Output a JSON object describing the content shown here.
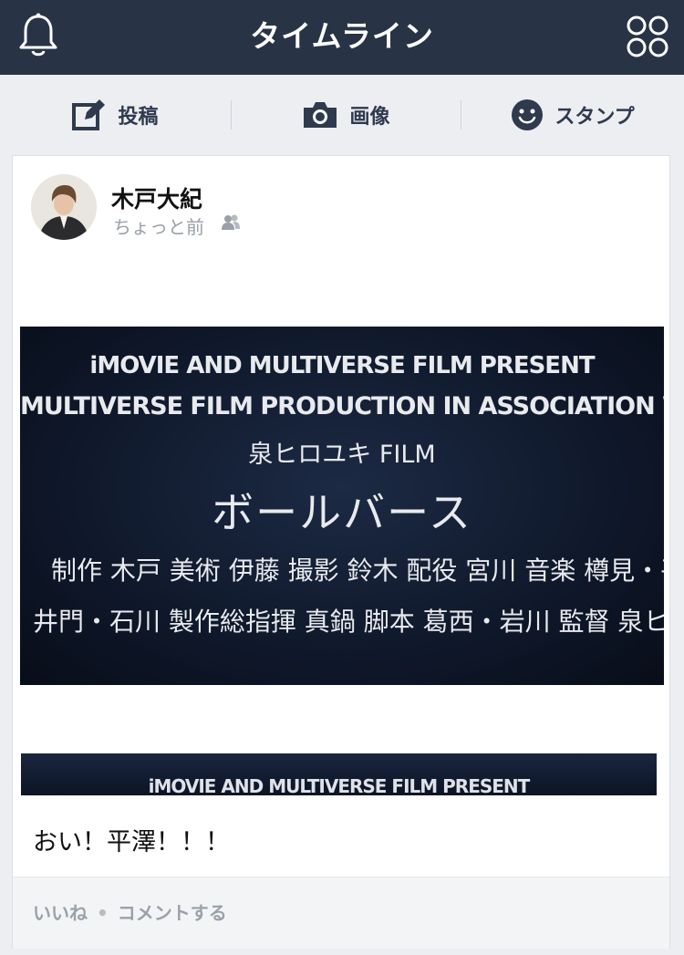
{
  "header": {
    "title": "タイムライン"
  },
  "actions": [
    {
      "label": "投稿",
      "icon": "compose-icon"
    },
    {
      "label": "画像",
      "icon": "camera-icon"
    },
    {
      "label": "スタンプ",
      "icon": "smiley-icon"
    }
  ],
  "post": {
    "author": "木戸大紀",
    "time": "ちょっと前",
    "credits": {
      "line1": "iMOVIE AND MULTIVERSE FILM PRESENT",
      "line2": "MULTIVERSE FILM PRODUCTION IN ASSOCIATION WITH iMOVIE",
      "line3": "泉ヒロユキ FILM",
      "title": "ボールバース",
      "line5": "制作 木戸 美術 伊藤 撮影 鈴木 配役 宮川 音楽 樽見・平澤",
      "line6": "井門・石川 製作総指揮 真鍋 脚本 葛西・岩川 監督 泉ヒロユキ"
    },
    "credits2": {
      "line1": "iMOVIE AND MULTIVERSE FILM PRESENT"
    },
    "text": "おい！平澤！！！"
  },
  "footer": {
    "like": "いいね",
    "comment": "コメントする"
  },
  "colors": {
    "header_bg": "#283346",
    "accent": "#2f3a4e"
  }
}
